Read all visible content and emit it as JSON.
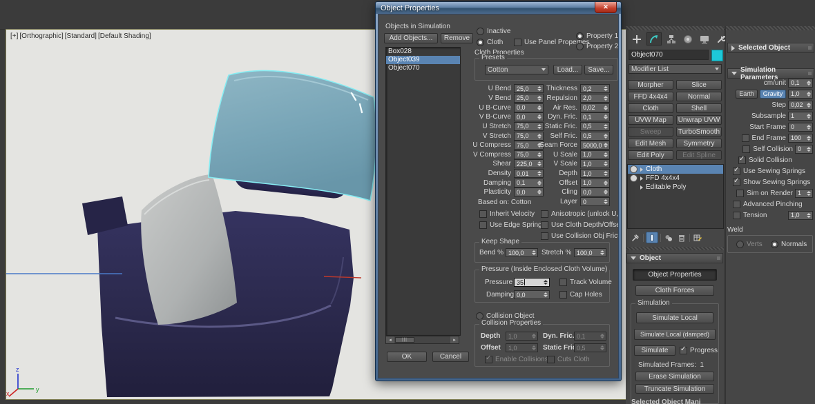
{
  "colors": {
    "selection_blue": "#5a84b2",
    "object_swatch": "#1ec8d8",
    "selected_outline": "#86ecf2",
    "viewport_bg": "#e4e4e1"
  },
  "viewport": {
    "label_parts": [
      "[+]",
      "[Orthographic]",
      "[Standard]",
      "[Default Shading]"
    ],
    "axis": {
      "x": "x",
      "y": "y",
      "z": "z"
    }
  },
  "dialog": {
    "title": "Object Properties",
    "close_label": "✕",
    "objects_in_simulation": "Objects in Simulation",
    "add_objects": "Add Objects...",
    "remove": "Remove",
    "objects": [
      {
        "name": "Box028"
      },
      {
        "name": "Object039",
        "selected": true
      },
      {
        "name": "Object070"
      }
    ],
    "inactive": "Inactive",
    "cloth": "Cloth",
    "use_panel_properties": "Use Panel Properties",
    "property1": "Property 1",
    "property2": "Property 2",
    "cloth_properties": "Cloth Properties",
    "presets_label": "Presets",
    "preset_value": "Cotton",
    "load": "Load...",
    "save": "Save...",
    "params_left": [
      {
        "label": "U Bend",
        "value": "25,0"
      },
      {
        "label": "V Bend",
        "value": "25,0"
      },
      {
        "label": "U B-Curve",
        "value": "0,0"
      },
      {
        "label": "V B-Curve",
        "value": "0,0"
      },
      {
        "label": "U Stretch",
        "value": "75,0"
      },
      {
        "label": "V Stretch",
        "value": "75,0"
      },
      {
        "label": "U Compress",
        "value": "75,0"
      },
      {
        "label": "V Compress",
        "value": "75,0"
      },
      {
        "label": "Shear",
        "value": "225,0"
      },
      {
        "label": "Density",
        "value": "0,01"
      },
      {
        "label": "Damping",
        "value": "0,1"
      },
      {
        "label": "Plasticity",
        "value": "0,0"
      }
    ],
    "based_on": "Based on: Cotton",
    "params_right": [
      {
        "label": "Thickness",
        "value": "0,2"
      },
      {
        "label": "Repulsion",
        "value": "2,0"
      },
      {
        "label": "Air Res.",
        "value": "0,02"
      },
      {
        "label": "Dyn. Fric.",
        "value": "0,1"
      },
      {
        "label": "Static Fric.",
        "value": "0,5"
      },
      {
        "label": "Self Fric.",
        "value": "0,5"
      },
      {
        "label": "Seam Force",
        "value": "5000,0"
      },
      {
        "label": "U Scale",
        "value": "1,0"
      },
      {
        "label": "V Scale",
        "value": "1,0"
      },
      {
        "label": "Depth",
        "value": "1,0"
      },
      {
        "label": "Offset",
        "value": "1,0"
      },
      {
        "label": "Cling",
        "value": "0,0"
      },
      {
        "label": "Layer",
        "value": "0"
      }
    ],
    "checks_left": [
      {
        "label": "Inherit Velocity"
      },
      {
        "label": "Use Edge Springs"
      }
    ],
    "checks_right": [
      {
        "label": "Anisotropic (unlock U,V)"
      },
      {
        "label": "Use Cloth Depth/Offset"
      },
      {
        "label": "Use Collision Obj Friction"
      }
    ],
    "keep_shape": {
      "title": "Keep Shape",
      "bend_label": "Bend %",
      "bend_value": "100,0",
      "stretch_label": "Stretch %",
      "stretch_value": "100,0"
    },
    "pressure": {
      "title": "Pressure (Inside Enclosed Cloth Volume)",
      "pressure_label": "Pressure",
      "pressure_value": "35",
      "track_volume": "Track Volume",
      "damping_label": "Damping",
      "damping_value": "0,0",
      "cap_holes": "Cap Holes"
    },
    "collision": {
      "radio_label": "Collision Object",
      "title": "Collision Properties",
      "depth_label": "Depth",
      "depth_value": "1,0",
      "dyn_label": "Dyn. Fric.",
      "dyn_value": "0,1",
      "offset_label": "Offset",
      "offset_value": "1,0",
      "static_label": "Static Fric.",
      "static_value": "0,5",
      "enable_collisions": "Enable Collisions",
      "cuts_cloth": "Cuts Cloth"
    },
    "ok": "OK",
    "cancel": "Cancel"
  },
  "command_panel": {
    "object_name": "Object070",
    "modifier_list": "Modifier List",
    "modifier_buttons": [
      {
        "label": "Morpher"
      },
      {
        "label": "Slice"
      },
      {
        "label": "FFD 4x4x4"
      },
      {
        "label": "Normal"
      },
      {
        "label": "Cloth"
      },
      {
        "label": "Shell"
      },
      {
        "label": "UVW Map"
      },
      {
        "label": "Unwrap UVW"
      },
      {
        "label": "Sweep",
        "disabled": true
      },
      {
        "label": "TurboSmooth"
      },
      {
        "label": "Edit Mesh"
      },
      {
        "label": "Symmetry"
      },
      {
        "label": "Edit Poly"
      },
      {
        "label": "Edit Spline",
        "disabled": true
      }
    ],
    "stack": [
      {
        "label": "Cloth",
        "selected": true,
        "eye": true
      },
      {
        "label": "FFD 4x4x4",
        "eye": true
      },
      {
        "label": "Editable Poly"
      }
    ],
    "object_rollout": {
      "title": "Object",
      "object_properties": "Object Properties",
      "cloth_forces": "Cloth Forces",
      "simulation_title": "Simulation",
      "simulate_local": "Simulate Local",
      "simulate_local_damped": "Simulate Local (damped)",
      "simulate": "Simulate",
      "progress": "Progress",
      "simulated_frames_label": "Simulated Frames:",
      "simulated_frames_value": "1",
      "erase": "Erase Simulation",
      "truncate": "Truncate Simulation"
    },
    "partial_bottom_text": "Selected Object Mani"
  },
  "right_panel": {
    "selected_object": "Selected Object",
    "simulation_parameters": "Simulation Parameters",
    "cm_unit_label": "cm/unit",
    "cm_unit_value": "0,1",
    "earth": "Earth",
    "gravity": "Gravity",
    "gravity_value": "1,0",
    "step_label": "Step",
    "step_value": "0,02",
    "subsample_label": "Subsample",
    "subsample_value": "1",
    "start_frame_label": "Start Frame",
    "start_frame_value": "0",
    "end_frame_label": "End Frame",
    "end_frame_value": "100",
    "self_collision_label": "Self Collision",
    "self_collision_value": "0",
    "solid_collision": "Solid Collision",
    "use_sewing_springs": "Use Sewing Springs",
    "show_sewing_springs": "Show Sewing Springs",
    "sim_on_render": "Sim on Render",
    "sim_on_render_value": "1",
    "advanced_pinching": "Advanced Pinching",
    "tension": "Tension",
    "tension_value": "1,0",
    "weld_title": "Weld",
    "verts": "Verts",
    "normals": "Normals"
  }
}
